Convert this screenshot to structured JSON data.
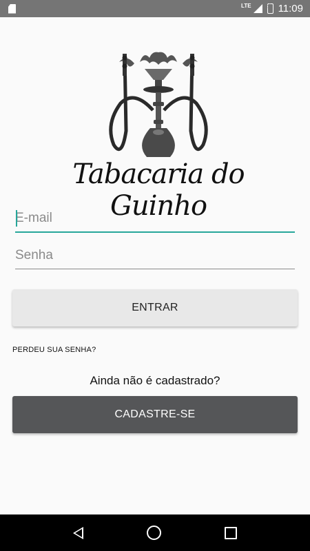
{
  "status_bar": {
    "network": "LTE",
    "time": "11:09",
    "icons": [
      "sd-card-icon",
      "signal-icon",
      "battery-charging-icon"
    ]
  },
  "logo": {
    "brand_name": "Tabacaria do Guinho",
    "icon": "hookah-logo-icon"
  },
  "login_form": {
    "email_placeholder": "E-mail",
    "email_value": "",
    "password_placeholder": "Senha",
    "password_value": "",
    "login_button_label": "ENTRAR",
    "forgot_password_label": "PERDEU SUA SENHA?",
    "not_registered_text": "Ainda não é cadastrado?",
    "register_button_label": "CADASTRE-SE"
  },
  "nav_bar": {
    "icons": [
      "back-icon",
      "home-icon",
      "recents-icon"
    ]
  },
  "colors": {
    "accent": "#26a69a",
    "register_button": "#555658",
    "login_button": "#e8e8e8",
    "status_bar": "#757575"
  }
}
